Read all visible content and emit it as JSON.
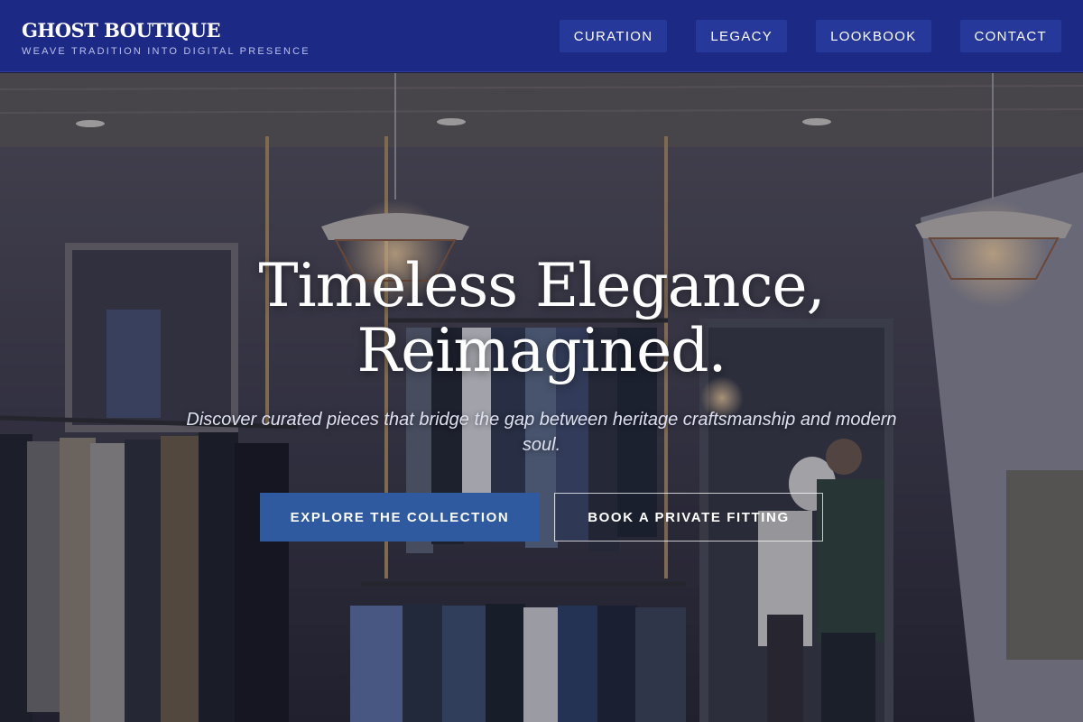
{
  "header": {
    "brand": "GHOST BOUTIQUE",
    "tagline": "WEAVE TRADITION INTO DIGITAL PRESENCE",
    "nav": [
      "CURATION",
      "LEGACY",
      "LOOKBOOK",
      "CONTACT"
    ]
  },
  "hero": {
    "title_line1": "Timeless Elegance,",
    "title_line2": "Reimagined.",
    "subtitle": "Discover curated pieces that bridge the gap between heritage craftsmanship and modern soul.",
    "primary_cta": "EXPLORE THE COLLECTION",
    "secondary_cta": "BOOK A PRIVATE FITTING",
    "background_image": "clothing-boutique-interior-photo"
  },
  "colors": {
    "header_bg": "#1c2a86",
    "nav_button_bg": "#26399a",
    "primary_button_bg": "#2f5aa0"
  }
}
